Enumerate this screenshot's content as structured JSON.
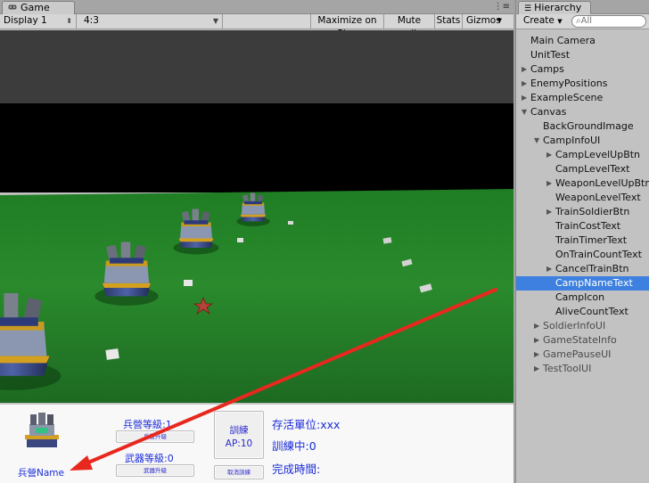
{
  "game_panel": {
    "tab_title": "Game",
    "display": "Display 1",
    "aspect": "4:3",
    "buttons": [
      "Maximize on Play",
      "Mute audio",
      "Stats",
      "Gizmos"
    ]
  },
  "hierarchy": {
    "tab_title": "Hierarchy",
    "create_label": "Create",
    "search_placeholder": "All",
    "items": [
      {
        "label": "Main Camera",
        "depth": 0,
        "expander": "none",
        "state": "normal"
      },
      {
        "label": "UnitTest",
        "depth": 0,
        "expander": "none",
        "state": "normal"
      },
      {
        "label": "Camps",
        "depth": 0,
        "expander": "collapsed",
        "state": "normal"
      },
      {
        "label": "EnemyPositions",
        "depth": 0,
        "expander": "collapsed",
        "state": "normal"
      },
      {
        "label": "ExampleScene",
        "depth": 0,
        "expander": "collapsed",
        "state": "normal"
      },
      {
        "label": "Canvas",
        "depth": 0,
        "expander": "expanded",
        "state": "normal"
      },
      {
        "label": "BackGroundImage",
        "depth": 1,
        "expander": "none",
        "state": "normal"
      },
      {
        "label": "CampInfoUI",
        "depth": 1,
        "expander": "expanded",
        "state": "normal"
      },
      {
        "label": "CampLevelUpBtn",
        "depth": 2,
        "expander": "collapsed",
        "state": "normal"
      },
      {
        "label": "CampLevelText",
        "depth": 2,
        "expander": "none",
        "state": "normal"
      },
      {
        "label": "WeaponLevelUpBtn",
        "depth": 2,
        "expander": "collapsed",
        "state": "normal"
      },
      {
        "label": "WeaponLevelText",
        "depth": 2,
        "expander": "none",
        "state": "normal"
      },
      {
        "label": "TrainSoldierBtn",
        "depth": 2,
        "expander": "collapsed",
        "state": "normal"
      },
      {
        "label": "TrainCostText",
        "depth": 2,
        "expander": "none",
        "state": "normal"
      },
      {
        "label": "TrainTimerText",
        "depth": 2,
        "expander": "none",
        "state": "normal"
      },
      {
        "label": "OnTrainCountText",
        "depth": 2,
        "expander": "none",
        "state": "normal"
      },
      {
        "label": "CancelTrainBtn",
        "depth": 2,
        "expander": "collapsed",
        "state": "normal"
      },
      {
        "label": "CampNameText",
        "depth": 2,
        "expander": "none",
        "state": "selected"
      },
      {
        "label": "CampIcon",
        "depth": 2,
        "expander": "none",
        "state": "normal"
      },
      {
        "label": "AliveCountText",
        "depth": 2,
        "expander": "none",
        "state": "normal"
      },
      {
        "label": "SoldierInfoUI",
        "depth": 1,
        "expander": "collapsed",
        "state": "disabled"
      },
      {
        "label": "GameStateInfo",
        "depth": 1,
        "expander": "collapsed",
        "state": "disabled"
      },
      {
        "label": "GamePauseUI",
        "depth": 1,
        "expander": "collapsed",
        "state": "disabled"
      },
      {
        "label": "TestToolUI",
        "depth": 1,
        "expander": "collapsed",
        "state": "disabled"
      }
    ]
  },
  "camp_ui": {
    "camp_name": "兵營Name",
    "camp_level": "兵營等級:1",
    "camp_level_btn": "兵營升級",
    "weapon_level": "武器等級:0",
    "weapon_level_btn": "武器升級",
    "train_btn_label": "訓練",
    "train_btn_cost": "AP:10",
    "cancel_btn": "取消訓練",
    "alive_units": "存活單位:xxx",
    "training": "訓練中:0",
    "finish_time": "完成時間:"
  },
  "colors": {
    "ui_text": "#1a2bd8",
    "selected_row": "#3d80df",
    "annotation_arrow": "#e8281e",
    "ground": "#2c7a2c",
    "sky": "#000000",
    "camera_clear": "#3a3a3a"
  }
}
